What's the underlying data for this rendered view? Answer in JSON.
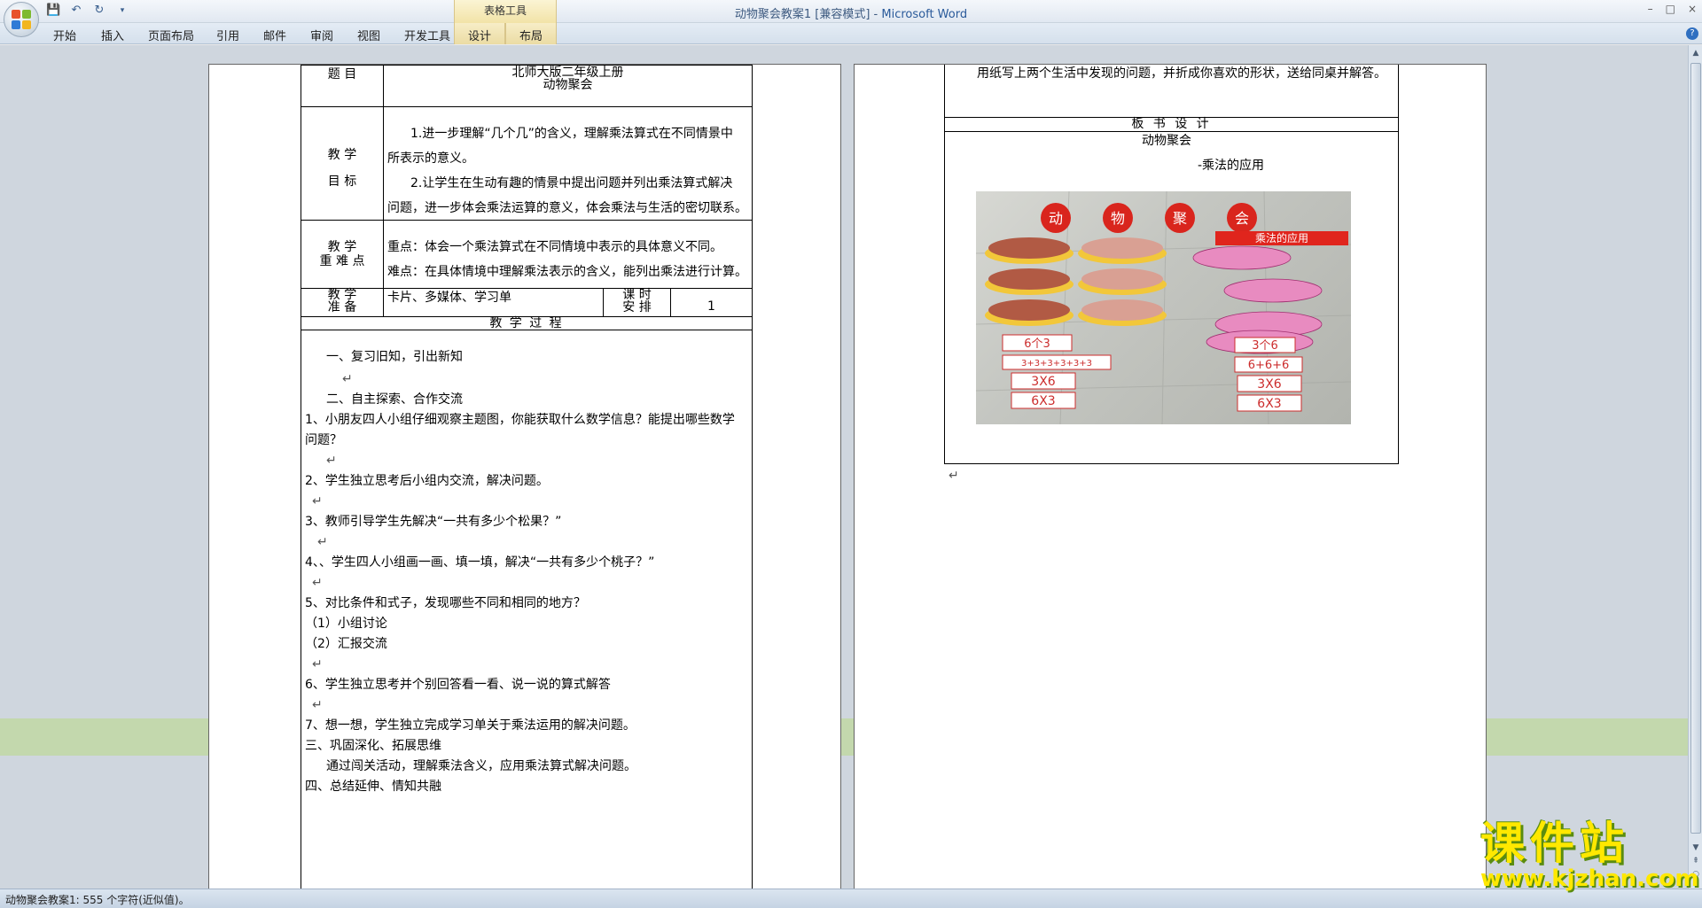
{
  "window": {
    "title_doc": "动物聚会教案1 [兼容模式] - ",
    "title_app": "Microsoft Word",
    "context_group": "表格工具",
    "minimize": "–",
    "maximize": "□",
    "close": "×",
    "help": "?"
  },
  "ribbon": {
    "tabs": [
      "开始",
      "插入",
      "页面布局",
      "引用",
      "邮件",
      "审阅",
      "视图",
      "开发工具"
    ],
    "context_tabs": [
      "设计",
      "布局"
    ]
  },
  "page1": {
    "r1_label": "题   目",
    "r1_line1": "北师大版二年级上册",
    "r1_line2": "动物聚会",
    "goals_label1": "教  学",
    "goals_label2": "目  标",
    "goal1a": "1.进一步理解“几个几”的含义，理解乘法算式在不同情景中",
    "goal1b": "所表示的意义。",
    "goal2a": "2.让学生在生动有趣的情景中提出问题并列出乘法算式解决",
    "goal2b": "问题，进一步体会乘法运算的意义，体会乘法与生活的密切联系。",
    "key_label1": "教  学",
    "key_label2": "重 难 点",
    "key1": "重点：体会一个乘法算式在不同情境中表示的具体意义不同。",
    "key2": "难点：在具体情境中理解乘法表示的含义，能列出乘法进行计算。",
    "prep_label1": "教 学",
    "prep_label2": "准 备",
    "prep_value": "卡片、多媒体、学习单",
    "time_label1": "课  时",
    "time_label2": "安  排",
    "time_value": "1",
    "process_header": "教 学 过 程",
    "lines": [
      "一、复习旧知，引出新知",
      "",
      "二、自主探索、合作交流",
      "1、小朋友四人小组仔细观察主题图，你能获取什么数学信息？能提出哪些数学",
      "问题？",
      "",
      "2、学生独立思考后小组内交流，解决问题。",
      "",
      " 3、教师引导学生先解决“一共有多少个松果？”",
      "",
      "4、、学生四人小组画一画、填一填，解决“一共有多少个桃子？”",
      "",
      "5、对比条件和式子，发现哪些不同和相同的地方？",
      "（1）小组讨论",
      "（2）汇报交流",
      "",
      "6、学生独立思考并个别回答看一看、说一说的算式解答",
      "",
      "7、想一想，学生独立完成学习单关于乘法运用的解决问题。",
      "三、巩固深化、拓展思维",
      "通过闯关活动，理解乘法含义，应用乘法算式解决问题。",
      "四、总结延伸、情知共融"
    ]
  },
  "page2": {
    "top_line": "用纸写上两个生活中发现的问题，并折成你喜欢的形状，送给同桌并解答。",
    "board_header": "板 书 设 计",
    "board_title": "动物聚会",
    "board_subtitle": "-乘法的应用",
    "photo": {
      "banner": [
        "动",
        "物",
        "聚",
        "会"
      ],
      "subtitle": "乘法的应用",
      "left_cards": [
        "6个3",
        "3+3+3+3+3+3",
        "3X6",
        "6X3"
      ],
      "right_cards": [
        "3个6",
        "6+6+6",
        "3X6",
        "6X3"
      ]
    }
  },
  "status": {
    "text": "动物聚会教案1: 555 个字符(近似值)。"
  },
  "watermark": {
    "big": "课件站",
    "url": "www.kjzhan.com"
  },
  "colors": {
    "doc_bg": "#a9b5c3",
    "title_app": "#2a5a9a",
    "context_tab": "#f2e3a7",
    "watermark_fill": "#ffe800",
    "watermark_shadow": "#5a8c10"
  }
}
